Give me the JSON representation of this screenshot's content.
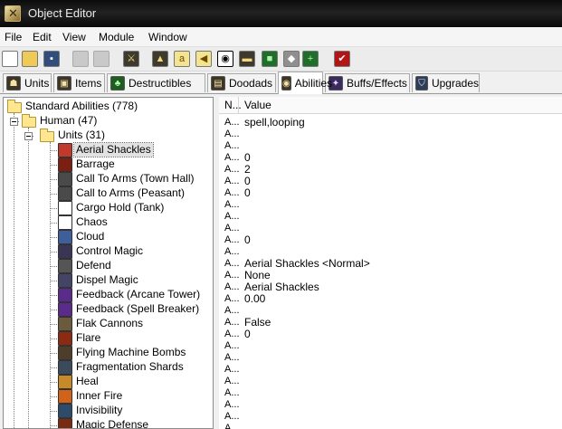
{
  "window": {
    "title": "Object Editor"
  },
  "menu": [
    "File",
    "Edit",
    "View",
    "Module",
    "Window"
  ],
  "toolbar": [
    {
      "icon": "new-document-icon",
      "glyph": ""
    },
    {
      "icon": "open-folder-icon",
      "glyph": ""
    },
    {
      "icon": "save-disk-icon",
      "glyph": "▪"
    },
    {
      "icon": "copy-icon",
      "glyph": ""
    },
    {
      "icon": "paste-icon",
      "glyph": ""
    },
    {
      "icon": "module-unit-icon",
      "glyph": "⚔"
    },
    {
      "icon": "terrain-editor-icon",
      "glyph": "▲"
    },
    {
      "icon": "trigger-editor-icon",
      "glyph": "a"
    },
    {
      "icon": "sound-editor-icon",
      "glyph": "◀"
    },
    {
      "icon": "object-editor-icon",
      "glyph": "◉"
    },
    {
      "icon": "campaign-editor-icon",
      "glyph": "▬"
    },
    {
      "icon": "ai-editor-icon",
      "glyph": "■"
    },
    {
      "icon": "import-manager-icon",
      "glyph": "◆"
    },
    {
      "icon": "import-add-icon",
      "glyph": "+"
    },
    {
      "icon": "test-map-icon",
      "glyph": "✔"
    }
  ],
  "tabs": [
    {
      "label": "Units",
      "icon": "units-tab-icon",
      "glyph": "☗"
    },
    {
      "label": "Items",
      "icon": "items-tab-icon",
      "glyph": "▣"
    },
    {
      "label": "Destructibles",
      "icon": "destructibles-tab-icon",
      "glyph": "♣"
    },
    {
      "label": "Doodads",
      "icon": "doodads-tab-icon",
      "glyph": "▤"
    },
    {
      "label": "Abilities",
      "icon": "abilities-tab-icon",
      "glyph": "◉"
    },
    {
      "label": "Buffs/Effects",
      "icon": "buffs-effects-tab-icon",
      "glyph": "✦"
    },
    {
      "label": "Upgrades",
      "icon": "upgrades-tab-icon",
      "glyph": "⛉"
    }
  ],
  "active_tab": "Abilities",
  "tree": {
    "root": "Standard Abilities (778)",
    "group": "Human (47)",
    "subgroup": "Units (31)",
    "selected": "Aerial Shackles",
    "items": [
      {
        "label": "Aerial Shackles",
        "icon": "aerial-shackles-icon",
        "color": "#c0392b"
      },
      {
        "label": "Barrage",
        "icon": "barrage-icon",
        "color": "#7a1f12"
      },
      {
        "label": "Call To Arms (Town Hall)",
        "icon": "call-to-arms-icon",
        "color": "#4a4a4a"
      },
      {
        "label": "Call to Arms (Peasant)",
        "icon": "call-to-arms-icon",
        "color": "#4a4a4a"
      },
      {
        "label": "Cargo Hold (Tank)",
        "icon": "cargo-hold-icon",
        "color": "#ffffff"
      },
      {
        "label": "Chaos",
        "icon": "chaos-icon",
        "color": "#ffffff"
      },
      {
        "label": "Cloud",
        "icon": "cloud-icon",
        "color": "#3e5f9c"
      },
      {
        "label": "Control Magic",
        "icon": "control-magic-icon",
        "color": "#3a3555"
      },
      {
        "label": "Defend",
        "icon": "defend-icon",
        "color": "#555555"
      },
      {
        "label": "Dispel Magic",
        "icon": "dispel-magic-icon",
        "color": "#444466"
      },
      {
        "label": "Feedback (Arcane Tower)",
        "icon": "feedback-icon",
        "color": "#5b2b8c"
      },
      {
        "label": "Feedback (Spell Breaker)",
        "icon": "feedback-icon",
        "color": "#5b2b8c"
      },
      {
        "label": "Flak Cannons",
        "icon": "flak-cannons-icon",
        "color": "#6b5a3b"
      },
      {
        "label": "Flare",
        "icon": "flare-icon",
        "color": "#8c2a12"
      },
      {
        "label": "Flying Machine Bombs",
        "icon": "flying-machine-bombs-icon",
        "color": "#4d3d2a"
      },
      {
        "label": "Fragmentation Shards",
        "icon": "fragmentation-shards-icon",
        "color": "#3b4a5c"
      },
      {
        "label": "Heal",
        "icon": "heal-icon",
        "color": "#c88a28"
      },
      {
        "label": "Inner Fire",
        "icon": "inner-fire-icon",
        "color": "#d0621a"
      },
      {
        "label": "Invisibility",
        "icon": "invisibility-icon",
        "color": "#2d4c6b"
      },
      {
        "label": "Magic Defense",
        "icon": "magic-defense-icon",
        "color": "#7a2a12"
      }
    ]
  },
  "value_table": {
    "headers": [
      "N...",
      "Value"
    ],
    "rows": [
      {
        "n": "A...",
        "v": "spell,looping"
      },
      {
        "n": "A...",
        "v": ""
      },
      {
        "n": "A...",
        "v": ""
      },
      {
        "n": "A...",
        "v": "0"
      },
      {
        "n": "A...",
        "v": "2"
      },
      {
        "n": "A...",
        "v": "0"
      },
      {
        "n": "A...",
        "v": "0"
      },
      {
        "n": "A...",
        "v": ""
      },
      {
        "n": "A...",
        "v": ""
      },
      {
        "n": "A...",
        "v": ""
      },
      {
        "n": "A...",
        "v": "0"
      },
      {
        "n": "A...",
        "v": ""
      },
      {
        "n": "A...",
        "v": "Aerial Shackles <Normal>"
      },
      {
        "n": "A...",
        "v": "None"
      },
      {
        "n": "A...",
        "v": "Aerial Shackles"
      },
      {
        "n": "A...",
        "v": "0.00"
      },
      {
        "n": "A...",
        "v": ""
      },
      {
        "n": "A...",
        "v": "False"
      },
      {
        "n": "A...",
        "v": "0"
      },
      {
        "n": "A...",
        "v": ""
      },
      {
        "n": "A...",
        "v": ""
      },
      {
        "n": "A...",
        "v": ""
      },
      {
        "n": "A...",
        "v": ""
      },
      {
        "n": "A...",
        "v": ""
      },
      {
        "n": "A...",
        "v": ""
      },
      {
        "n": "A...",
        "v": ""
      },
      {
        "n": "A...",
        "v": ""
      },
      {
        "n": "A...",
        "v": ""
      }
    ]
  }
}
